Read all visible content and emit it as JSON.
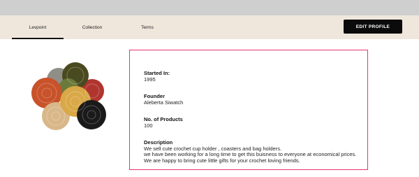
{
  "nav": {
    "tabs": [
      {
        "label": "Levpoint",
        "active": true
      },
      {
        "label": "Collection",
        "active": false
      },
      {
        "label": "Terms",
        "active": false
      }
    ],
    "edit_button_label": "EDIT PROFILE"
  },
  "product_image": {
    "description_icon": "crochet-coasters-image",
    "colors": [
      "#c8522a",
      "#6b7a3a",
      "#4a4a20",
      "#b0352f",
      "#d9a847",
      "#d8b889",
      "#1a1a1a",
      "#8f8f88"
    ]
  },
  "profile": {
    "started_in": {
      "label": "Started In:",
      "value": "1995"
    },
    "founder": {
      "label": "Founder",
      "value": "Aleberta Siwatch"
    },
    "products": {
      "label": "No. of Products",
      "value": "100"
    },
    "description": {
      "label": "Description",
      "lines": [
        "We sell cute crochet cup holder , coasters and bag holders.",
        "we have been working for a long time to get this buisness to everyone at economical prices.",
        "We are happy to bring cute little gifts for your crochet loving friends."
      ]
    }
  },
  "colors": {
    "accent_border": "#e8336d",
    "nav_background": "#efe7dc",
    "button_background": "#0b0b0b",
    "top_strip": "#cfcfcf"
  }
}
